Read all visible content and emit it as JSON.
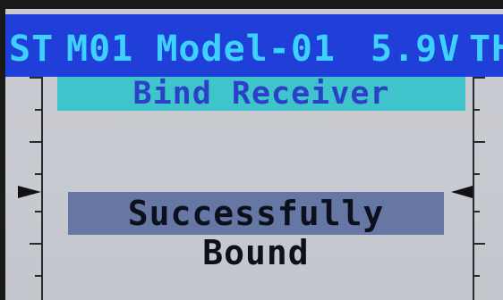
{
  "status_bar": {
    "left_label": "ST",
    "model": "M01 Model-01",
    "voltage": "5.9V",
    "right_label": "TH"
  },
  "screen": {
    "title": "Bind Receiver",
    "message": "Successfully Bound"
  },
  "colors": {
    "status_bar_bg": "#1f3fd8",
    "status_text": "#3ed0ff",
    "title_bg": "#3fc4cc",
    "title_text": "#2b3fc7",
    "message_bg": "#6677a4",
    "message_text": "#0c0f1c",
    "screen_bg": "#c6c9cf"
  },
  "icons": {
    "left_trim": "trim-scale-left-icon",
    "right_trim": "trim-scale-right-icon",
    "left_pointer": "left-trim-pointer-icon",
    "right_pointer": "right-trim-pointer-icon"
  }
}
